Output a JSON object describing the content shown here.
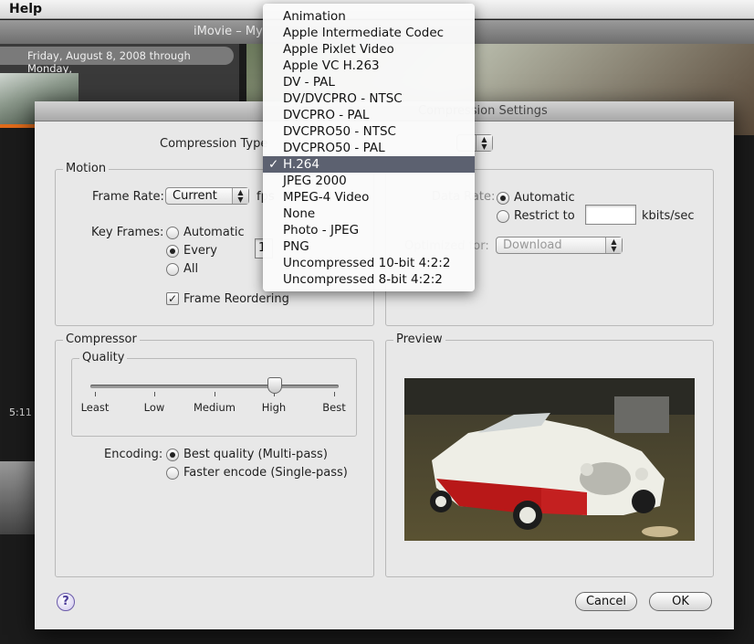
{
  "menubar": {
    "help_label": "Help"
  },
  "background": {
    "window_title": "iMovie – My",
    "date_range": "Friday, August 8, 2008 through Monday,",
    "timecode": "5:11"
  },
  "dialog": {
    "title": "Compression Settings",
    "compression_type_label": "Compression Type",
    "motion": {
      "group_label": "Motion",
      "frame_rate_label": "Frame Rate:",
      "frame_rate_value": "Current",
      "fps_label": "fps",
      "key_frames_label": "Key Frames:",
      "key_frame_options": [
        "Automatic",
        "Every",
        "All"
      ],
      "key_frame_selected": "Every",
      "every_value": "1",
      "frame_reordering_label": "Frame Reordering",
      "frame_reordering_checked": true
    },
    "data_rate": {
      "label": "Data Rate:",
      "automatic_label": "Automatic",
      "restrict_label": "Restrict to",
      "restrict_value": "",
      "units": "kbits/sec",
      "selected": "Automatic",
      "optimized_for_label": "Optimized for:",
      "optimized_for_value": "Download"
    },
    "compressor": {
      "group_label": "Compressor",
      "quality_label": "Quality",
      "quality_ticks": [
        "Least",
        "Low",
        "Medium",
        "High",
        "Best"
      ],
      "quality_value": "High",
      "quality_level": 0.75,
      "encoding_label": "Encoding:",
      "encoding_options": [
        "Best quality (Multi-pass)",
        "Faster encode (Single-pass)"
      ],
      "encoding_selected": "Best quality (Multi-pass)"
    },
    "preview": {
      "group_label": "Preview"
    },
    "buttons": {
      "help": "?",
      "cancel": "Cancel",
      "ok": "OK"
    }
  },
  "compression_menu": {
    "items": [
      "Animation",
      "Apple Intermediate Codec",
      "Apple Pixlet Video",
      "Apple VC H.263",
      "DV - PAL",
      "DV/DVCPRO - NTSC",
      "DVCPRO - PAL",
      "DVCPRO50 - NTSC",
      "DVCPRO50 - PAL",
      "H.264",
      "JPEG 2000",
      "MPEG-4 Video",
      "None",
      "Photo - JPEG",
      "PNG",
      "Uncompressed 10-bit 4:2:2",
      "Uncompressed 8-bit 4:2:2"
    ],
    "selected": "H.264",
    "checkmark": "✓"
  },
  "colors": {
    "menu_highlight": "#5c6170",
    "dialog_bg": "#e8e8e8",
    "accent_orange": "#e06b1b"
  }
}
